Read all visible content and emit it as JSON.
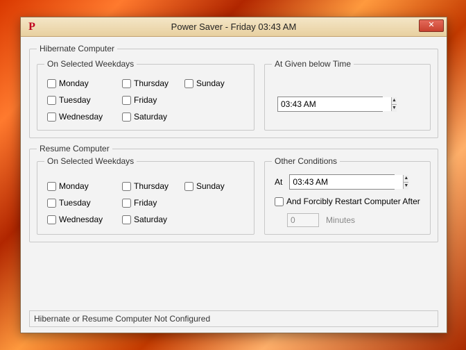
{
  "window": {
    "title": "Power Saver - Friday 03:43 AM",
    "app_icon_letter": "P"
  },
  "hibernate": {
    "legend": "Hibernate Computer",
    "weekdays_legend": "On Selected Weekdays",
    "time_legend": "At Given below Time",
    "time_value": "03:43 AM"
  },
  "resume": {
    "legend": "Resume Computer",
    "weekdays_legend": "On Selected Weekdays",
    "other_legend": "Other Conditions",
    "at_label": "At",
    "time_value": "03:43 AM",
    "forcibly_label": "And Forcibly Restart Computer After",
    "minutes_value": "0",
    "minutes_label": "Minutes"
  },
  "days": {
    "mon": "Monday",
    "tue": "Tuesday",
    "wed": "Wednesday",
    "thu": "Thursday",
    "fri": "Friday",
    "sat": "Saturday",
    "sun": "Sunday"
  },
  "status": "Hibernate or Resume Computer Not Configured"
}
